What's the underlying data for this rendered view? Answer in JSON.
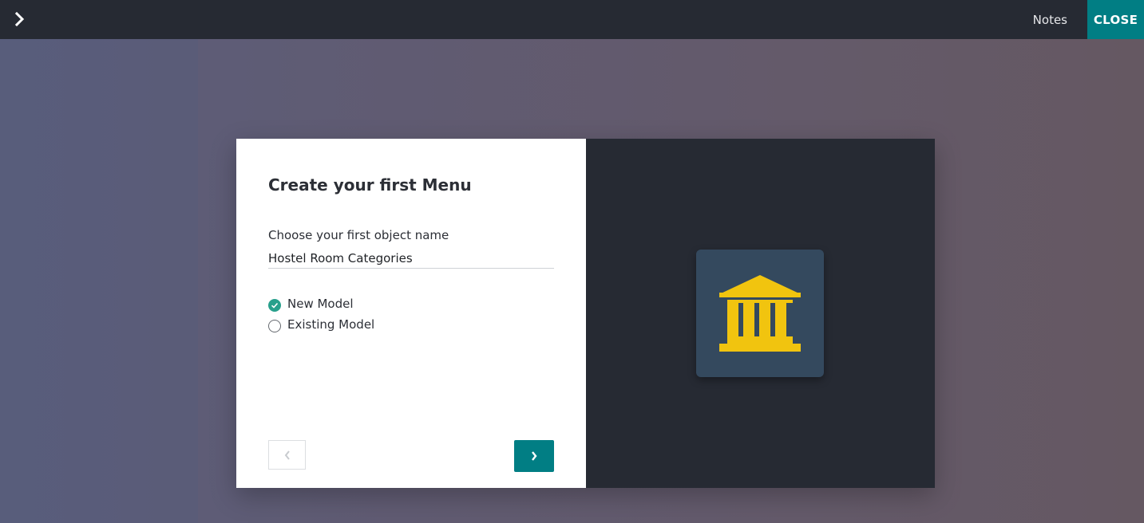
{
  "topbar": {
    "notes_label": "Notes",
    "close_label": "CLOSE",
    "accent_color": "#017e84"
  },
  "dialog": {
    "title": "Create your first Menu",
    "field_label": "Choose your first object name",
    "field_value": "Hostel Room Categories",
    "options": [
      {
        "label": "New Model",
        "checked": true
      },
      {
        "label": "Existing Model",
        "checked": false
      }
    ],
    "prev_icon": "chevron-left-icon",
    "next_icon": "chevron-right-icon",
    "app_icon": "bank-icon",
    "app_icon_color": "#f1c40f",
    "app_icon_bg": "#34495e"
  }
}
